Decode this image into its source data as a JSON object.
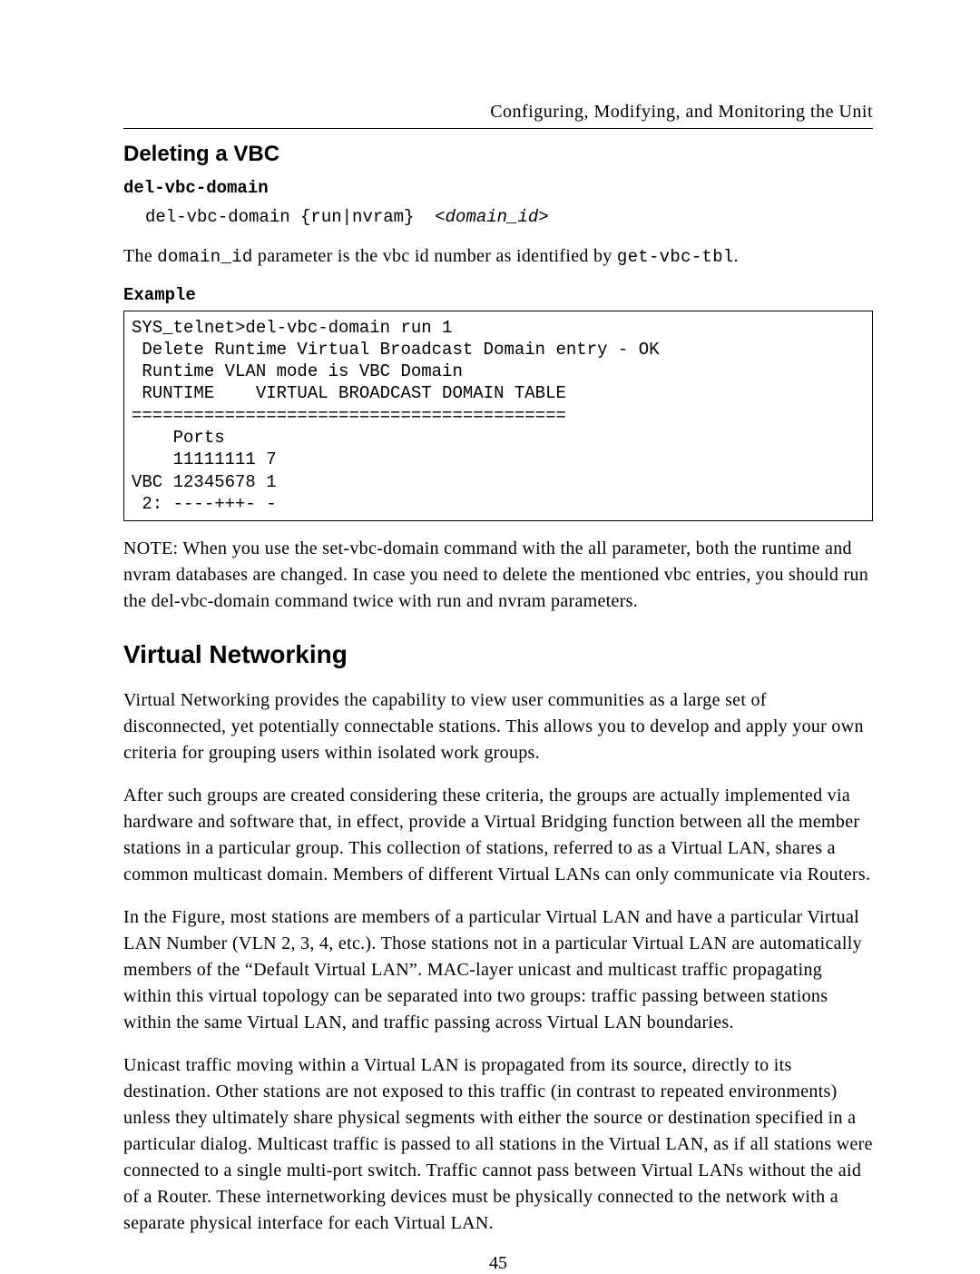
{
  "header": {
    "running_title": "Configuring, Modifying, and Monitoring the Unit"
  },
  "section_delete_vbc": {
    "title": "Deleting a VBC",
    "cmd_heading": "del-vbc-domain",
    "syntax_prefix": "del-vbc-domain {run|nvram}  <",
    "syntax_var": "domain_id",
    "syntax_suffix": ">",
    "desc_pre": "The ",
    "desc_code1": "domain_id",
    "desc_mid": " parameter is the vbc id number as identified by ",
    "desc_code2": "get-vbc-tbl",
    "desc_post": ".",
    "example_label": "Example",
    "example_code": "SYS_telnet>del-vbc-domain run 1\n Delete Runtime Virtual Broadcast Domain entry - OK\n Runtime VLAN mode is VBC Domain\n RUNTIME    VIRTUAL BROADCAST DOMAIN TABLE\n==========================================\n    Ports\n    11111111 7\nVBC 12345678 1\n 2: ----+++- -",
    "note": "NOTE:  When you use the set-vbc-domain command with the all parameter, both the runtime and nvram databases are changed.  In case you need to delete the mentioned vbc entries, you should run the del-vbc-domain command twice with run and nvram parameters."
  },
  "section_vn": {
    "title": "Virtual Networking",
    "p1": "Virtual Networking provides the capability to view user communities as a large set of disconnected, yet potentially connectable stations.  This allows you to develop and apply your own criteria for grouping users within isolated work groups.",
    "p2": "After such groups are created considering these criteria, the groups are actually implemented via hardware and software that, in effect, provide a Virtual Bridging function between all the member stations in a particular group.  This collection of stations, referred to as a Virtual LAN, shares a common multicast domain.  Members of different Virtual LANs can only communicate via Routers.",
    "p3": "In the Figure, most stations are members of a particular Virtual LAN and have a particular Virtual LAN Number (VLN 2, 3, 4, etc.).  Those stations not in a particular Virtual LAN are automatically members of the “Default Virtual LAN”.  MAC-layer unicast and multicast traffic propagating within this virtual topology can be separated into two groups: traffic passing between stations within the same Virtual LAN, and traffic passing across Virtual LAN boundaries.",
    "p4": "Unicast traffic moving within a Virtual LAN is propagated from its source, directly to its destination.  Other stations are not exposed to this traffic (in contrast to repeated environments) unless they ultimately share physical segments with either the source or destination specified in a particular dialog.  Multicast traffic is passed to all stations in the Virtual LAN, as if all stations were connected to a single multi-port switch.  Traffic cannot pass between Virtual LANs without the aid of a Router.  These internetworking devices must be physically connected to the network with a separate physical interface for each Virtual LAN."
  },
  "page_number": "45"
}
